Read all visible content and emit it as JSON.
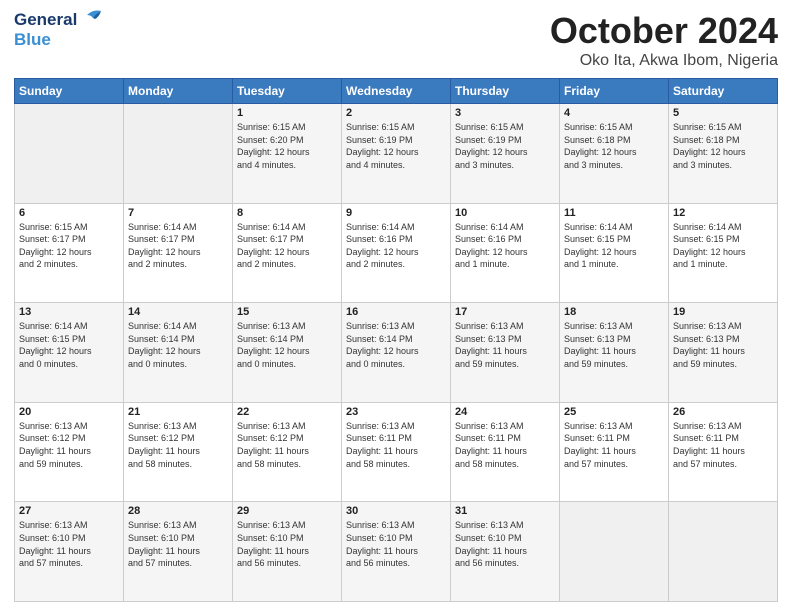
{
  "header": {
    "logo_general": "General",
    "logo_blue": "Blue",
    "month": "October 2024",
    "location": "Oko Ita, Akwa Ibom, Nigeria"
  },
  "days_of_week": [
    "Sunday",
    "Monday",
    "Tuesday",
    "Wednesday",
    "Thursday",
    "Friday",
    "Saturday"
  ],
  "weeks": [
    [
      {
        "day": "",
        "info": ""
      },
      {
        "day": "",
        "info": ""
      },
      {
        "day": "1",
        "info": "Sunrise: 6:15 AM\nSunset: 6:20 PM\nDaylight: 12 hours\nand 4 minutes."
      },
      {
        "day": "2",
        "info": "Sunrise: 6:15 AM\nSunset: 6:19 PM\nDaylight: 12 hours\nand 4 minutes."
      },
      {
        "day": "3",
        "info": "Sunrise: 6:15 AM\nSunset: 6:19 PM\nDaylight: 12 hours\nand 3 minutes."
      },
      {
        "day": "4",
        "info": "Sunrise: 6:15 AM\nSunset: 6:18 PM\nDaylight: 12 hours\nand 3 minutes."
      },
      {
        "day": "5",
        "info": "Sunrise: 6:15 AM\nSunset: 6:18 PM\nDaylight: 12 hours\nand 3 minutes."
      }
    ],
    [
      {
        "day": "6",
        "info": "Sunrise: 6:15 AM\nSunset: 6:17 PM\nDaylight: 12 hours\nand 2 minutes."
      },
      {
        "day": "7",
        "info": "Sunrise: 6:14 AM\nSunset: 6:17 PM\nDaylight: 12 hours\nand 2 minutes."
      },
      {
        "day": "8",
        "info": "Sunrise: 6:14 AM\nSunset: 6:17 PM\nDaylight: 12 hours\nand 2 minutes."
      },
      {
        "day": "9",
        "info": "Sunrise: 6:14 AM\nSunset: 6:16 PM\nDaylight: 12 hours\nand 2 minutes."
      },
      {
        "day": "10",
        "info": "Sunrise: 6:14 AM\nSunset: 6:16 PM\nDaylight: 12 hours\nand 1 minute."
      },
      {
        "day": "11",
        "info": "Sunrise: 6:14 AM\nSunset: 6:15 PM\nDaylight: 12 hours\nand 1 minute."
      },
      {
        "day": "12",
        "info": "Sunrise: 6:14 AM\nSunset: 6:15 PM\nDaylight: 12 hours\nand 1 minute."
      }
    ],
    [
      {
        "day": "13",
        "info": "Sunrise: 6:14 AM\nSunset: 6:15 PM\nDaylight: 12 hours\nand 0 minutes."
      },
      {
        "day": "14",
        "info": "Sunrise: 6:14 AM\nSunset: 6:14 PM\nDaylight: 12 hours\nand 0 minutes."
      },
      {
        "day": "15",
        "info": "Sunrise: 6:13 AM\nSunset: 6:14 PM\nDaylight: 12 hours\nand 0 minutes."
      },
      {
        "day": "16",
        "info": "Sunrise: 6:13 AM\nSunset: 6:14 PM\nDaylight: 12 hours\nand 0 minutes."
      },
      {
        "day": "17",
        "info": "Sunrise: 6:13 AM\nSunset: 6:13 PM\nDaylight: 11 hours\nand 59 minutes."
      },
      {
        "day": "18",
        "info": "Sunrise: 6:13 AM\nSunset: 6:13 PM\nDaylight: 11 hours\nand 59 minutes."
      },
      {
        "day": "19",
        "info": "Sunrise: 6:13 AM\nSunset: 6:13 PM\nDaylight: 11 hours\nand 59 minutes."
      }
    ],
    [
      {
        "day": "20",
        "info": "Sunrise: 6:13 AM\nSunset: 6:12 PM\nDaylight: 11 hours\nand 59 minutes."
      },
      {
        "day": "21",
        "info": "Sunrise: 6:13 AM\nSunset: 6:12 PM\nDaylight: 11 hours\nand 58 minutes."
      },
      {
        "day": "22",
        "info": "Sunrise: 6:13 AM\nSunset: 6:12 PM\nDaylight: 11 hours\nand 58 minutes."
      },
      {
        "day": "23",
        "info": "Sunrise: 6:13 AM\nSunset: 6:11 PM\nDaylight: 11 hours\nand 58 minutes."
      },
      {
        "day": "24",
        "info": "Sunrise: 6:13 AM\nSunset: 6:11 PM\nDaylight: 11 hours\nand 58 minutes."
      },
      {
        "day": "25",
        "info": "Sunrise: 6:13 AM\nSunset: 6:11 PM\nDaylight: 11 hours\nand 57 minutes."
      },
      {
        "day": "26",
        "info": "Sunrise: 6:13 AM\nSunset: 6:11 PM\nDaylight: 11 hours\nand 57 minutes."
      }
    ],
    [
      {
        "day": "27",
        "info": "Sunrise: 6:13 AM\nSunset: 6:10 PM\nDaylight: 11 hours\nand 57 minutes."
      },
      {
        "day": "28",
        "info": "Sunrise: 6:13 AM\nSunset: 6:10 PM\nDaylight: 11 hours\nand 57 minutes."
      },
      {
        "day": "29",
        "info": "Sunrise: 6:13 AM\nSunset: 6:10 PM\nDaylight: 11 hours\nand 56 minutes."
      },
      {
        "day": "30",
        "info": "Sunrise: 6:13 AM\nSunset: 6:10 PM\nDaylight: 11 hours\nand 56 minutes."
      },
      {
        "day": "31",
        "info": "Sunrise: 6:13 AM\nSunset: 6:10 PM\nDaylight: 11 hours\nand 56 minutes."
      },
      {
        "day": "",
        "info": ""
      },
      {
        "day": "",
        "info": ""
      }
    ]
  ]
}
